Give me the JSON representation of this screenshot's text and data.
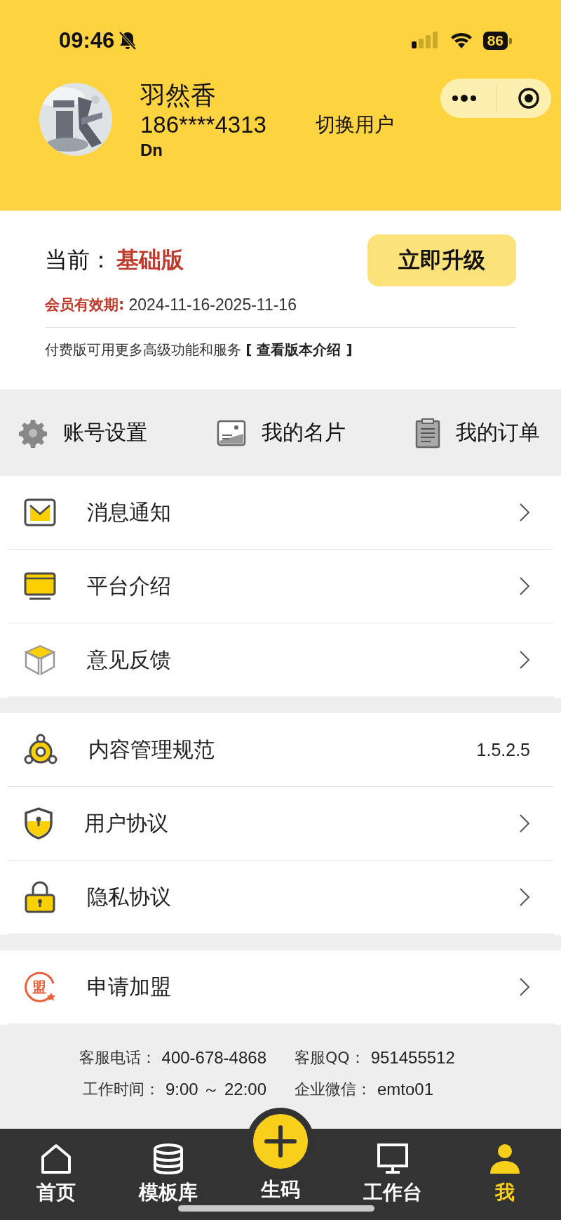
{
  "status_bar": {
    "time": "09:46",
    "battery": "86"
  },
  "profile": {
    "name": "羽然香",
    "phone": "186****4313",
    "switch_user": "切换用户",
    "tag": "Dn"
  },
  "membership": {
    "current_label": "当前：",
    "plan": "基础版",
    "upgrade_button": "立即升级",
    "validity_label": "会员有效期:",
    "validity": "2024-11-16-2025-11-16",
    "promo": "付费版可用更多高级功能和服务",
    "promo_link": "[ 查看版本介绍 ]"
  },
  "quick_links": [
    {
      "label": "账号设置"
    },
    {
      "label": "我的名片"
    },
    {
      "label": "我的订单"
    }
  ],
  "menu_groups": [
    [
      {
        "label": "消息通知",
        "kind": "link"
      },
      {
        "label": "平台介绍",
        "kind": "link"
      },
      {
        "label": "意见反馈",
        "kind": "link"
      }
    ],
    [
      {
        "label": "内容管理规范",
        "kind": "version",
        "value": "1.5.2.5"
      },
      {
        "label": "用户协议",
        "kind": "link"
      },
      {
        "label": "隐私协议",
        "kind": "link"
      }
    ],
    [
      {
        "label": "申请加盟",
        "kind": "link",
        "seal": "盟"
      }
    ]
  ],
  "contact": [
    {
      "label": "客服电话：",
      "value": "400-678-4868"
    },
    {
      "label": "客服QQ：",
      "value": "951455512"
    },
    {
      "label": "工作时间：",
      "value": "9:00 ～ 22:00"
    },
    {
      "label": "企业微信：",
      "value": "emto01"
    }
  ],
  "tabs": [
    {
      "label": "首页",
      "selected": false
    },
    {
      "label": "模板库",
      "selected": false
    },
    {
      "label": "生码",
      "selected": false
    },
    {
      "label": "工作台",
      "selected": false
    },
    {
      "label": "我",
      "selected": true
    }
  ]
}
